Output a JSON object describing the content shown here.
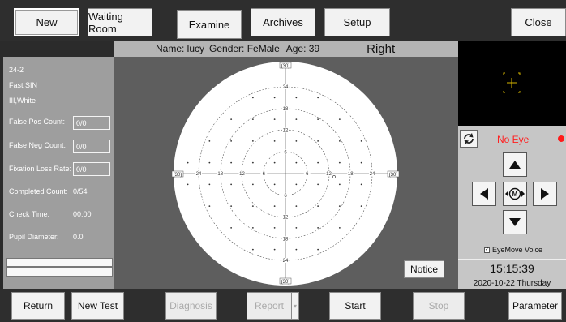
{
  "toolbar": {
    "new": "New",
    "waiting_room": "Waiting Room",
    "examine": "Examine",
    "archives": "Archives",
    "setup": "Setup",
    "close": "Close"
  },
  "patient": {
    "name_label": "Name: lucy",
    "gender_label": "Gender: FeMale",
    "age_label": "Age: 39",
    "eye": "Right"
  },
  "test": {
    "program": "24-2",
    "strategy": "Fast SIN",
    "stimulus": "III,White",
    "false_pos_label": "False Pos Count:",
    "false_pos_value": "0/0",
    "false_neg_label": "False Neg Count:",
    "false_neg_value": "0/0",
    "fixation_loss_label": "Fixation Loss Rate:",
    "fixation_loss_value": "0/0",
    "completed_label": "Completed Count:",
    "completed_value": "0/54",
    "check_time_label": "Check Time:",
    "check_time_value": "00:00",
    "pupil_label": "Pupil Diameter:",
    "pupil_value": "0.0"
  },
  "plot": {
    "axis_end_label": "(30)",
    "ticks": [
      "24",
      "18",
      "12",
      "6"
    ],
    "notice": "Notice"
  },
  "control": {
    "eye_status": "No Eye",
    "m_label": "M",
    "voice_label": "EyeMove Voice",
    "time": "15:15:39",
    "date": "2020-10-22  Thursday"
  },
  "bottom": {
    "return": "Return",
    "new_test": "New Test",
    "diagnosis": "Diagnosis",
    "report": "Report",
    "start": "Start",
    "stop": "Stop",
    "parameter": "Parameter"
  },
  "colors": {
    "status_red": "#ff1a1a",
    "camera_crosshair": "#d4b300",
    "panel_gray": "#9e9e9e"
  }
}
